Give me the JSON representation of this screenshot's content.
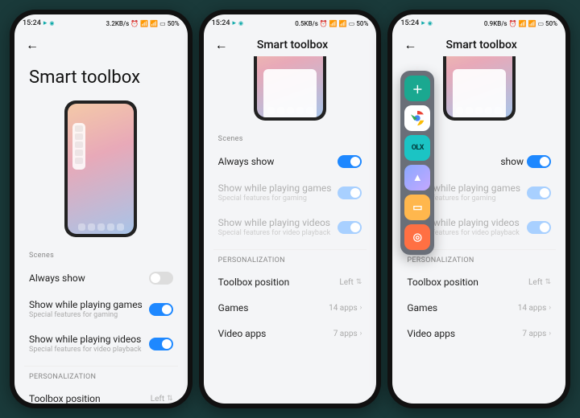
{
  "status": {
    "time": "15:24",
    "speed1": "3.2KB/s",
    "speed2": "0.5KB/s",
    "speed3": "0.9KB/s",
    "battery": "50%"
  },
  "title": "Smart toolbox",
  "sections": {
    "scenes": "Scenes",
    "personalization": "PERSONALIZATION"
  },
  "rows": {
    "always": {
      "label": "Always show"
    },
    "games": {
      "label": "Show while playing games",
      "sub": "Special features for gaming"
    },
    "videos": {
      "label": "Show while playing videos",
      "sub": "Special features for video playback"
    },
    "position": {
      "label": "Toolbox position",
      "value": "Left"
    },
    "gamesApps": {
      "label": "Games",
      "value": "14 apps"
    },
    "videoApps": {
      "label": "Video apps",
      "value": "7 apps"
    }
  },
  "toolbox": {
    "olx": "OLX",
    "show_fragment": "show"
  }
}
